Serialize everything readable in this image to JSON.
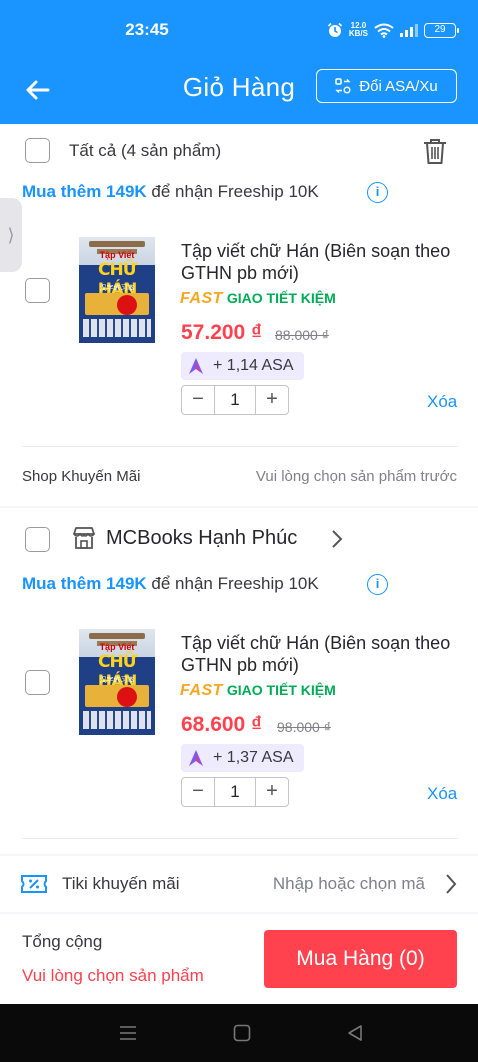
{
  "status_bar": {
    "time": "23:45",
    "speed_value": "12.0",
    "speed_unit": "KB/S",
    "battery": "29"
  },
  "header": {
    "title": "Giỏ Hàng",
    "exchange_label": "Đổi ASA/Xu"
  },
  "select_all": {
    "label": "Tất cả (4 sản phẩm)"
  },
  "shop1": {
    "freeship_highlight": "Mua thêm 149K",
    "freeship_rest": " để nhận Freeship 10K",
    "product": {
      "name": "Tập viết chữ Hán (Biên soạn theo GTHN pb mới)",
      "fast": "FAST",
      "shipping": "GIAO TIẾT KIỆM",
      "price": "57.200 ₫",
      "old_price": "88.000 ₫",
      "asa": "+ 1,14 ASA",
      "quantity": "1",
      "delete_label": "Xóa"
    },
    "promo_label": "Shop Khuyến Mãi",
    "promo_hint": "Vui lòng chọn sản phẩm trước"
  },
  "shop2": {
    "name": "MCBooks Hạnh Phúc",
    "freeship_highlight": "Mua thêm 149K",
    "freeship_rest": " để nhận Freeship 10K",
    "product": {
      "name": "Tập viết chữ Hán (Biên soạn theo GTHN pb mới)",
      "fast": "FAST",
      "shipping": "GIAO TIẾT KIỆM",
      "price": "68.600 ₫",
      "old_price": "98.000 ₫",
      "asa": "+ 1,37 ASA",
      "quantity": "1",
      "delete_label": "Xóa"
    }
  },
  "tiki_promo": {
    "label": "Tiki khuyến mãi",
    "hint": "Nhập hoặc chọn mã"
  },
  "footer": {
    "total_label": "Tổng cộng",
    "total_hint": "Vui lòng chọn sản phẩm",
    "buy_label": "Mua Hàng (0)"
  },
  "book_cover": {
    "line1": "Tập Viết",
    "line2": "CHỮ HÁN",
    "line3": "汉字练习本"
  },
  "colors": {
    "brand_blue": "#1a94ff",
    "price_red": "#ff424e",
    "fast_orange": "#f5a623",
    "ship_green": "#00ab56"
  }
}
